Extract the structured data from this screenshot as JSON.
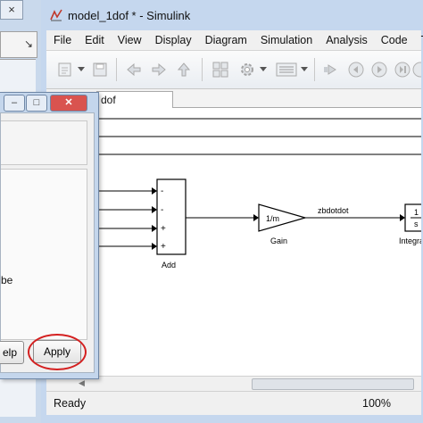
{
  "window": {
    "title": "model_1dof * - Simulink"
  },
  "background_window": {
    "close_glyph": "×",
    "dropdown_glyph": "↘"
  },
  "menu": {
    "items": [
      "File",
      "Edit",
      "View",
      "Display",
      "Diagram",
      "Simulation",
      "Analysis",
      "Code",
      "To"
    ]
  },
  "toolbar": {
    "icons": [
      "new-model-icon",
      "save-icon",
      "back-arrow-icon",
      "forward-arrow-icon",
      "up-arrow-icon",
      "library-browser-icon",
      "model-settings-gear-icon",
      "model-explorer-icon",
      "step-back-icon",
      "run-icon",
      "step-forward-icon",
      "stop-icon"
    ]
  },
  "tab": {
    "label": "dof"
  },
  "diagram": {
    "add_block": {
      "label": "Add",
      "port_signs": [
        "-",
        "-",
        "+",
        "+"
      ]
    },
    "gain_block": {
      "label": "Gain",
      "value": "1/m"
    },
    "signal_label": "zbdotdot",
    "integrator_block": {
      "label": "Integra",
      "numerator": "1",
      "denominator": "s"
    }
  },
  "status": {
    "ready": "Ready",
    "zoom": "100%"
  },
  "dialog": {
    "panel_text": "be",
    "help_label": "elp",
    "apply_label": "Apply",
    "minimize_glyph": "–",
    "maximize_glyph": "□",
    "close_glyph": "✕"
  },
  "colors": {
    "window_frame": "#c5d7ee",
    "highlight_circle": "#d42020",
    "close_button": "#d9534f"
  }
}
